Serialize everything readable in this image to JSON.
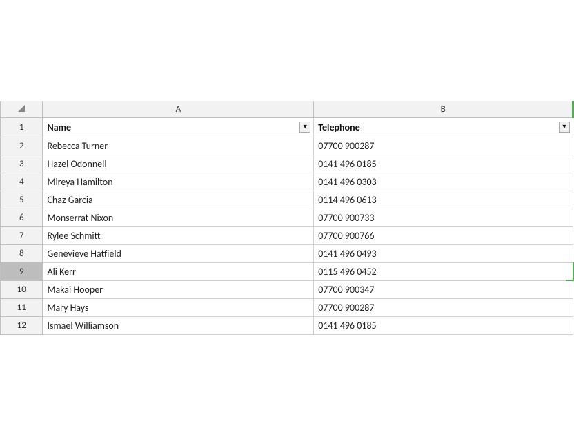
{
  "columns": {
    "row_num_header": "",
    "col_a_label": "A",
    "col_b_label": "B"
  },
  "header_row": {
    "row_num": "1",
    "name_label": "Name",
    "phone_label": "Telephone"
  },
  "rows": [
    {
      "row_num": "2",
      "name": "Rebecca Turner",
      "phone": "07700 900287"
    },
    {
      "row_num": "3",
      "name": "Hazel Odonnell",
      "phone": "0141 496 0185"
    },
    {
      "row_num": "4",
      "name": "Mireya Hamilton",
      "phone": "0141 496 0303"
    },
    {
      "row_num": "5",
      "name": "Chaz Garcia",
      "phone": "0114 496 0613"
    },
    {
      "row_num": "6",
      "name": "Monserrat Nixon",
      "phone": "07700 900733"
    },
    {
      "row_num": "7",
      "name": "Rylee Schmitt",
      "phone": "07700 900766"
    },
    {
      "row_num": "8",
      "name": "Genevieve Hatfield",
      "phone": "0141 496 0493"
    },
    {
      "row_num": "9",
      "name": "Ali Kerr",
      "phone": "0115 496 0452",
      "selected": true
    },
    {
      "row_num": "10",
      "name": "Makai Hooper",
      "phone": "07700 900347"
    },
    {
      "row_num": "11",
      "name": "Mary Hays",
      "phone": "07700 900287"
    },
    {
      "row_num": "12",
      "name": "Ismael Williamson",
      "phone": "0141 496 0185"
    }
  ],
  "dropdown_arrow": "▼"
}
